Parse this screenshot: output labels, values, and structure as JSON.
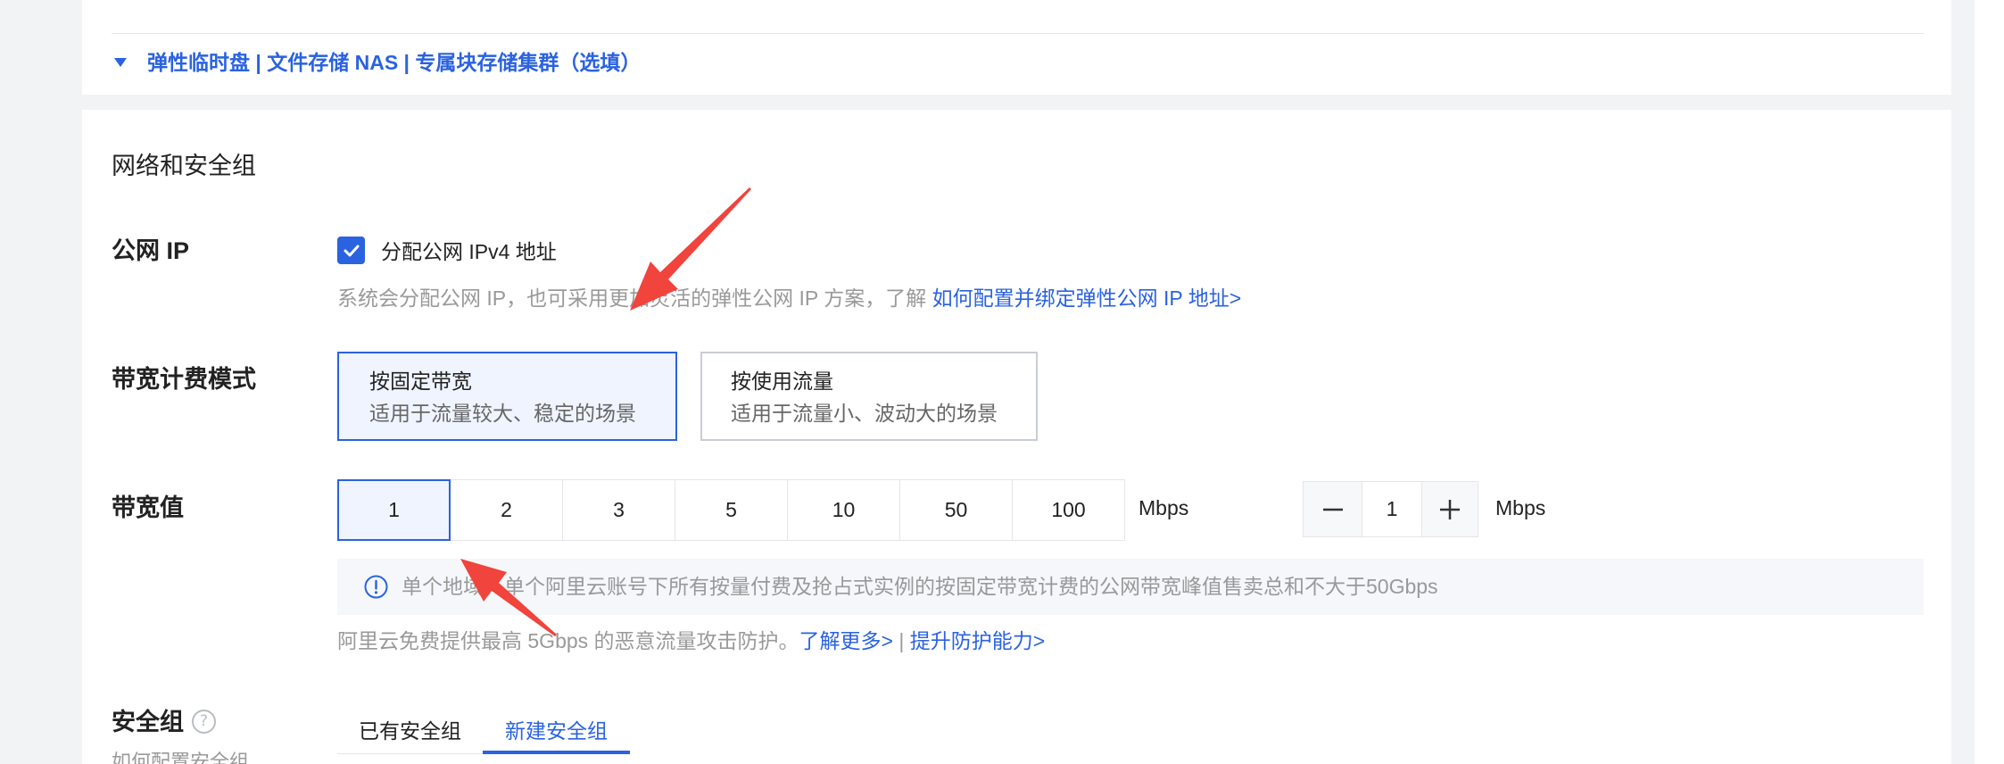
{
  "colors": {
    "primary": "#2a62e0",
    "selected_bg": "#eff4ff",
    "annotation_arrow": "#f0443c"
  },
  "icons": {
    "collapse": "caret-down-icon",
    "checkbox": "check-icon",
    "notice": "info-icon",
    "help": "question-icon",
    "stepper_minus": "minus-icon",
    "stepper_plus": "plus-icon"
  },
  "storage_collapse": {
    "label": "弹性临时盘 | 文件存储 NAS | 专属块存储集群（选填）"
  },
  "section_title": "网络和安全组",
  "public_ip": {
    "label": "公网 IP",
    "checkbox_label": "分配公网 IPv4 地址",
    "checked": true,
    "help_text": "系统会分配公网 IP，也可采用更加灵活的弹性公网 IP 方案，了解 ",
    "help_link": "如何配置并绑定弹性公网 IP 地址>"
  },
  "billing_mode": {
    "label": "带宽计费模式",
    "options": [
      {
        "title": "按固定带宽",
        "desc": "适用于流量较大、稳定的场景",
        "selected": true
      },
      {
        "title": "按使用流量",
        "desc": "适用于流量小、波动大的场景",
        "selected": false
      }
    ]
  },
  "bandwidth": {
    "label": "带宽值",
    "presets": [
      "1",
      "2",
      "3",
      "5",
      "10",
      "50",
      "100"
    ],
    "selected": "1",
    "unit": "Mbps",
    "stepper_value": "1",
    "stepper_unit": "Mbps",
    "notice": "单个地域，单个阿里云账号下所有按量付费及抢占式实例的按固定带宽计费的公网带宽峰值售卖总和不大于50Gbps",
    "protect_text": "阿里云免费提供最高 5Gbps 的恶意流量攻击防护。",
    "learn_more": "了解更多>",
    "separator": " | ",
    "upgrade_link": "提升防护能力>"
  },
  "security_group": {
    "label": "安全组",
    "help_hint": "如何配置安全组",
    "tabs": [
      {
        "label": "已有安全组",
        "active": false
      },
      {
        "label": "新建安全组",
        "active": true
      }
    ]
  }
}
